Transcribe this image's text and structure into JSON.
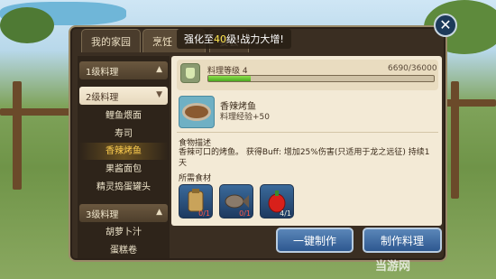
{
  "tabs": [
    {
      "label": "我的家园"
    },
    {
      "label": "烹饪"
    },
    {
      "label": "宴会"
    }
  ],
  "toast": {
    "prefix": "强化至",
    "highlight": "40",
    "suffix": "级!战力大增!"
  },
  "categories": {
    "level1": {
      "label": "1级料理"
    },
    "level2": {
      "label": "2级料理",
      "items": [
        "鲤鱼煨面",
        "寿司",
        "香辣烤鱼",
        "果酱面包",
        "精灵捣蛋罐头"
      ]
    },
    "level3": {
      "label": "3级料理",
      "items": [
        "胡萝卜汁",
        "蛋糕卷"
      ]
    }
  },
  "level": {
    "label": "料理等级 4",
    "value": "6690/36000",
    "progress": 0.186
  },
  "dish": {
    "name": "香辣烤鱼",
    "exp": "料理经验+50"
  },
  "description": {
    "title": "食物描述",
    "text": "香辣可口的烤鱼。 获得Buff: 增加25%伤害(只适用于龙之远征) 持续1天"
  },
  "ingredients": {
    "title": "所需食材",
    "items": [
      {
        "icon": "seasoning-icon",
        "count": "0/1"
      },
      {
        "icon": "fish-icon",
        "count": "0/1"
      },
      {
        "icon": "pepper-icon",
        "count": "4/1"
      }
    ]
  },
  "buttons": {
    "one_click": "一键制作",
    "make": "制作料理"
  },
  "watermark": "当游网"
}
